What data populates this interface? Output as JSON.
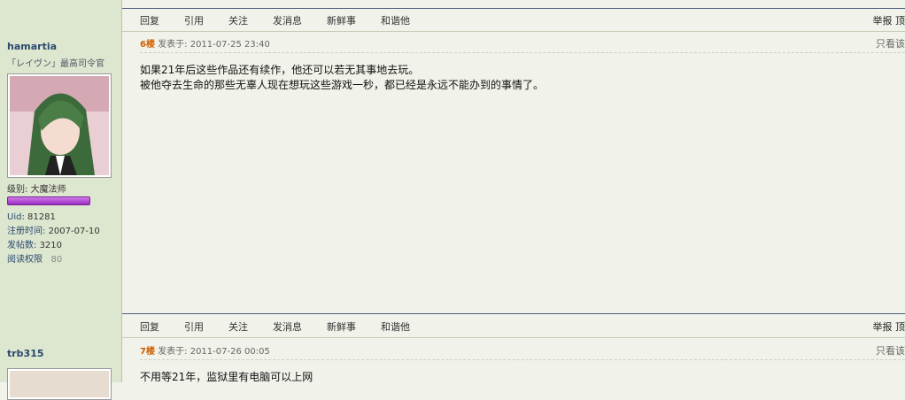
{
  "actions": {
    "items": [
      "回复",
      "引用",
      "关注",
      "发消息",
      "新鲜事",
      "和谐他"
    ],
    "report": "举报 顶"
  },
  "post6": {
    "floor": "6楼",
    "meta": "发表于: 2011-07-25 23:40",
    "only_author": "只看该",
    "lines": [
      "如果21年后这些作品还有续作，他还可以若无其事地去玩。",
      "被他夺去生命的那些无辜人现在想玩这些游戏一秒，都已经是永远不能办到的事情了。"
    ],
    "user": {
      "name": "hamartia",
      "title": "「レイヴン」最高司令官",
      "level": "级别: 大魔法师",
      "uid_label": "Uid:",
      "uid": "81281",
      "reg_label": "注册时间:",
      "reg": "2007-07-10",
      "posts_label": "发帖数:",
      "posts": "3210",
      "perm_label": "阅读权限",
      "perm": "80"
    }
  },
  "post7": {
    "floor": "7楼",
    "meta": "发表于: 2011-07-26 00:05",
    "only_author": "只看该",
    "lines": [
      "不用等21年，监狱里有电脑可以上网"
    ],
    "user": {
      "name": "trb315"
    }
  }
}
